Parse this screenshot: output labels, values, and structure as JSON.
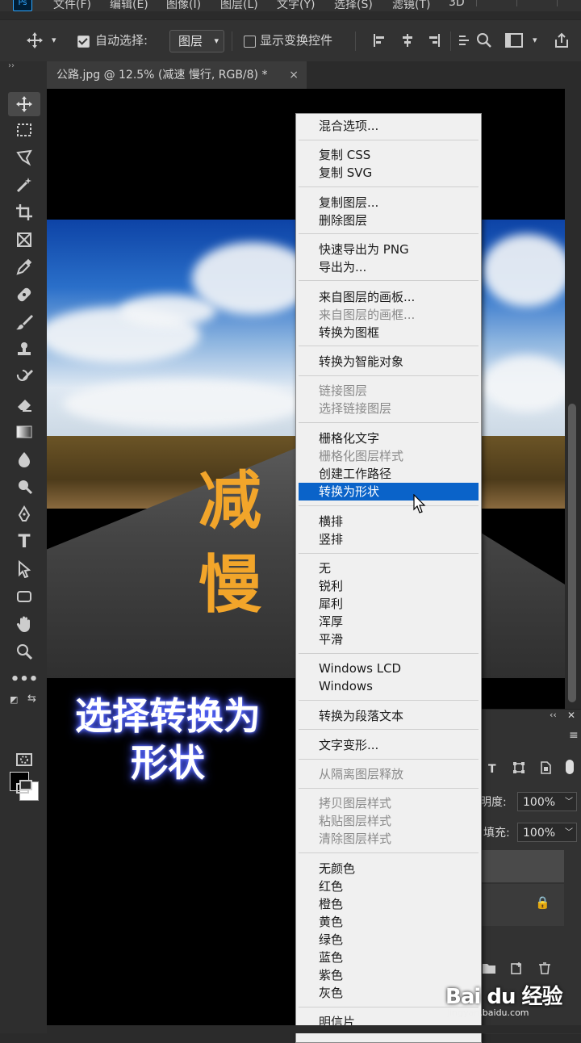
{
  "menubar": {
    "items": [
      "文件(F)",
      "编辑(E)",
      "图像(I)",
      "图层(L)",
      "文字(Y)",
      "选择(S)",
      "滤镜(T)",
      "3D"
    ]
  },
  "options": {
    "auto_select_label": "自动选择:",
    "auto_select_target": "图层",
    "show_transform_label": "显示变换控件"
  },
  "document_tab": {
    "title": "公路.jpg @ 12.5% (减速 慢行, RGB/8) *",
    "close": "×"
  },
  "canvas": {
    "word1": "减",
    "word2": "慢",
    "caption_line1": "选择转换为",
    "caption_line2": "形状"
  },
  "context_menu": {
    "items": [
      {
        "label": "混合选项...",
        "disabled": false
      },
      {
        "label": "复制 CSS",
        "disabled": false
      },
      {
        "label": "复制 SVG",
        "disabled": false
      },
      {
        "label": "复制图层...",
        "disabled": false
      },
      {
        "label": "删除图层",
        "disabled": false
      },
      {
        "label": "快速导出为 PNG",
        "disabled": false
      },
      {
        "label": "导出为...",
        "disabled": false
      },
      {
        "label": "来自图层的画板...",
        "disabled": false
      },
      {
        "label": "来自图层的画框...",
        "disabled": true
      },
      {
        "label": "转换为图框",
        "disabled": false
      },
      {
        "label": "转换为智能对象",
        "disabled": false
      },
      {
        "label": "链接图层",
        "disabled": true
      },
      {
        "label": "选择链接图层",
        "disabled": true
      },
      {
        "label": "栅格化文字",
        "disabled": false
      },
      {
        "label": "栅格化图层样式",
        "disabled": true
      },
      {
        "label": "创建工作路径",
        "disabled": false
      },
      {
        "label": "转换为形状",
        "disabled": false,
        "highlighted": true
      },
      {
        "label": "横排",
        "disabled": false
      },
      {
        "label": "竖排",
        "disabled": false
      },
      {
        "label": "无",
        "disabled": false
      },
      {
        "label": "锐利",
        "disabled": false
      },
      {
        "label": "犀利",
        "disabled": false
      },
      {
        "label": "浑厚",
        "disabled": false
      },
      {
        "label": "平滑",
        "disabled": false
      },
      {
        "label": "Windows LCD",
        "disabled": false
      },
      {
        "label": "Windows",
        "disabled": false
      },
      {
        "label": "转换为段落文本",
        "disabled": false
      },
      {
        "label": "文字变形...",
        "disabled": false
      },
      {
        "label": "从隔离图层释放",
        "disabled": true
      },
      {
        "label": "拷贝图层样式",
        "disabled": true
      },
      {
        "label": "粘贴图层样式",
        "disabled": true
      },
      {
        "label": "清除图层样式",
        "disabled": true
      },
      {
        "label": "无颜色",
        "disabled": false
      },
      {
        "label": "红色",
        "disabled": false
      },
      {
        "label": "橙色",
        "disabled": false
      },
      {
        "label": "黄色",
        "disabled": false
      },
      {
        "label": "绿色",
        "disabled": false
      },
      {
        "label": "蓝色",
        "disabled": false
      },
      {
        "label": "紫色",
        "disabled": false
      },
      {
        "label": "灰色",
        "disabled": false
      },
      {
        "label": "明信片",
        "disabled": false
      }
    ]
  },
  "layers_panel": {
    "opacity_label": "明度:",
    "opacity_value": "100%",
    "fill_label": "填充:",
    "fill_value": "100%"
  },
  "watermark": {
    "brand": "Bai du 经验",
    "url": "jingyan.baidu.com"
  },
  "colors": {
    "accent": "#0a63c9",
    "word_orange": "#f2a52a",
    "caption_glow": "#5b6cff"
  }
}
